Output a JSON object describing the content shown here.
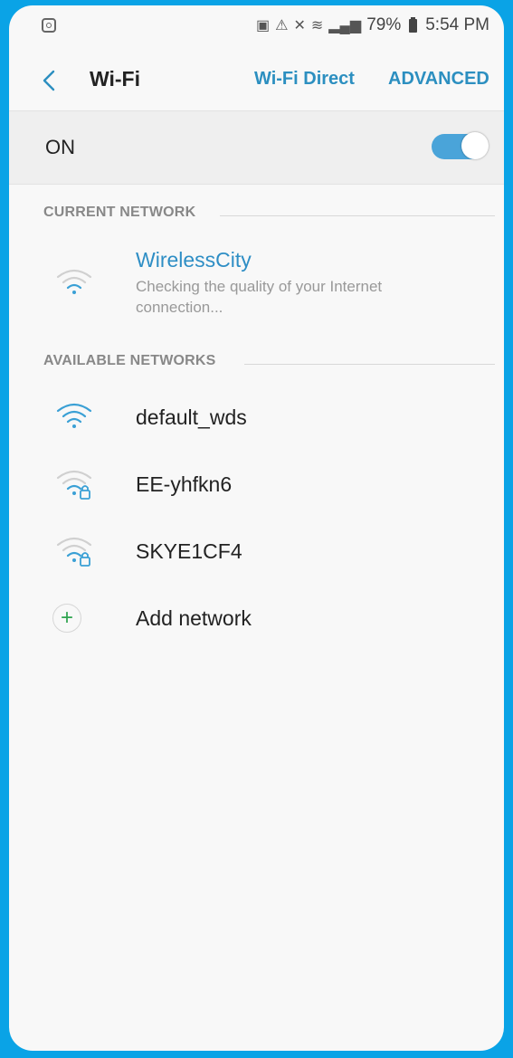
{
  "status_bar": {
    "percent": "79%",
    "time": "5:54 PM",
    "icons": [
      "instagram-icon",
      "sim-icon",
      "data-saver-icon",
      "mute-icon",
      "wifi-calling-icon",
      "signal-icon",
      "battery-icon"
    ]
  },
  "header": {
    "back_icon": "back-arrow-icon",
    "title": "Wi-Fi",
    "wifi_direct": "Wi-Fi Direct",
    "advanced": "ADVANCED"
  },
  "wifi_toggle": {
    "label": "ON",
    "state": "on",
    "accent": "#4aa4d9"
  },
  "current_network": {
    "section": "CURRENT NETWORK",
    "name": "WirelessCity",
    "status": "Checking the quality of your Internet connection...",
    "icon": "wifi-icon"
  },
  "available_networks": {
    "section": "AVAILABLE NETWORKS",
    "items": [
      {
        "name": "default_wds",
        "icon": "wifi-icon",
        "secured": false
      },
      {
        "name": "EE-yhfkn6",
        "icon": "wifi-locked-icon",
        "secured": true
      },
      {
        "name": "SKYE1CF4",
        "icon": "wifi-locked-icon",
        "secured": true
      }
    ],
    "add": "Add network",
    "add_icon": "plus-icon"
  },
  "colors": {
    "frame": "#0aa3e6",
    "link": "#2c8fc0",
    "current_name": "#2e8ec5"
  }
}
